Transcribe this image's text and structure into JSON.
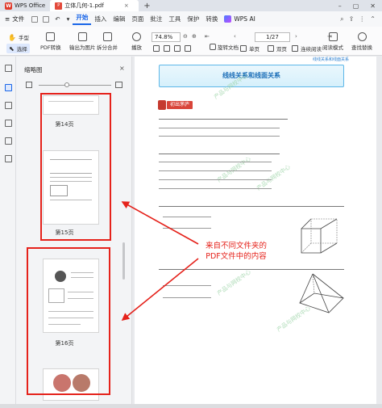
{
  "titlebar": {
    "app_name": "WPS Office",
    "doc_tab": "立体几何-1.pdf",
    "close_tab": "×",
    "add_tab": "+"
  },
  "menu": {
    "file": "文件",
    "items": [
      "开始",
      "插入",
      "编辑",
      "页面",
      "批注",
      "工具",
      "保护",
      "转换"
    ],
    "active": "开始",
    "wps_ai": "WPS AI"
  },
  "ribbon": {
    "hand_tool": "手型",
    "select_tool": "选择",
    "pdf_convert": "PDF转换",
    "export_image": "输出为图片",
    "split_merge": "拆分合并",
    "play": "播放",
    "zoom": "74.8%",
    "page_indicator": "1/27",
    "rotate_doc": "旋转文档",
    "single_page": "单页",
    "double_page": "双页",
    "continuous_read": "连续阅读",
    "read_mode": "阅读模式",
    "find_replace": "查找替换"
  },
  "thumbnail_panel": {
    "title": "缩略图",
    "pages": [
      {
        "label": "第14页"
      },
      {
        "label": "第15页"
      },
      {
        "label": "第16页"
      }
    ]
  },
  "document": {
    "header_note": "线线关系和线面关系",
    "banner_title": "线线关系和线面关系",
    "section_tag": "初出茅庐",
    "watermark": "产品与网校中心"
  },
  "annotation": {
    "callout_line1": "来自不同文件夹的",
    "callout_line2": "PDF文件中的内容"
  },
  "colors": {
    "accent": "#1a66e8",
    "annotation_red": "#e5221b",
    "banner_blue": "#5db7e8"
  }
}
